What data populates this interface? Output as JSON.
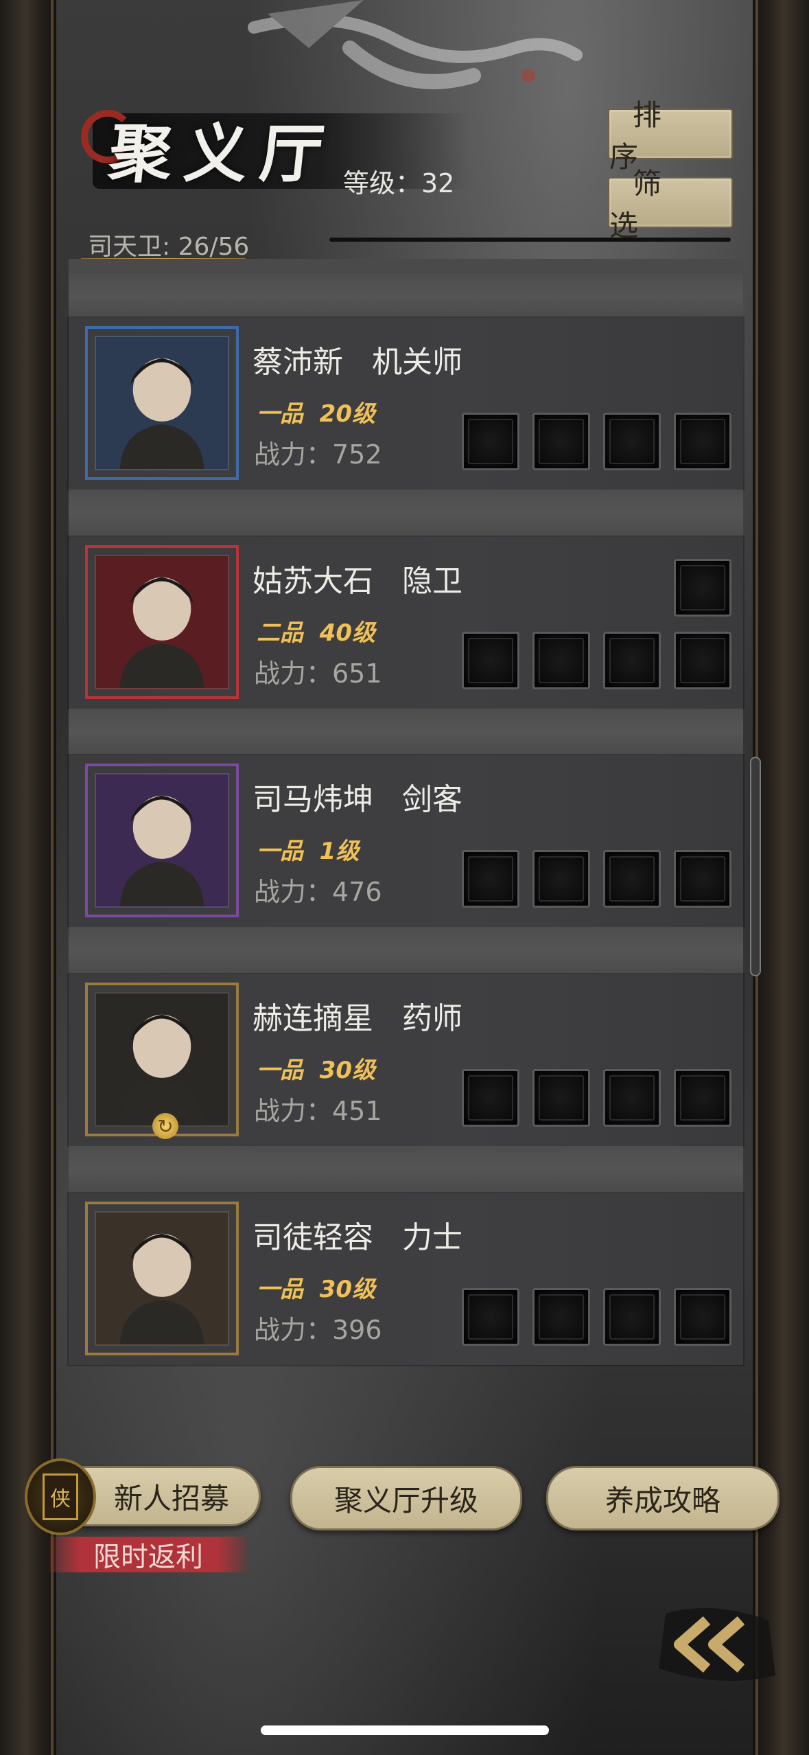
{
  "header": {
    "title": "聚义厅",
    "level_text": "等级：32",
    "guard_count": "司天卫: 26/56",
    "sort_label": "排序",
    "filter_label": "筛选"
  },
  "heroes": [
    {
      "name": "蔡沛新   机关师",
      "rank": "一品  20级",
      "power": "战力：752",
      "frame_color": "#3d6aa8",
      "bg_color": "#2c3a52",
      "extra_slot": false,
      "badge": false
    },
    {
      "name": "姑苏大石   隐卫",
      "rank": "二品  40级",
      "power": "战力：651",
      "frame_color": "#b8333a",
      "bg_color": "#5a1e22",
      "extra_slot": true,
      "badge": false
    },
    {
      "name": "司马炜坤   剑客",
      "rank": "一品  1级",
      "power": "战力：476",
      "frame_color": "#7a4aa0",
      "bg_color": "#3c2a52",
      "extra_slot": false,
      "badge": false
    },
    {
      "name": "赫连摘星   药师",
      "rank": "一品  30级",
      "power": "战力：451",
      "frame_color": "#9a7a3e",
      "bg_color": "#2a2824",
      "extra_slot": false,
      "badge": true
    },
    {
      "name": "司徒轻容   力士",
      "rank": "一品  30级",
      "power": "战力：396",
      "frame_color": "#9a7a3e",
      "bg_color": "#3a3228",
      "extra_slot": false,
      "badge": false
    }
  ],
  "bottom": {
    "recruit_label": "新人招募",
    "upgrade_label": "聚义厅升级",
    "guide_label": "养成攻略",
    "promo_label": "限时返利",
    "recruit_icon_glyph": "侠"
  },
  "icons": {
    "back": "double-chevron-left-icon",
    "cycle": "cycle-icon"
  }
}
